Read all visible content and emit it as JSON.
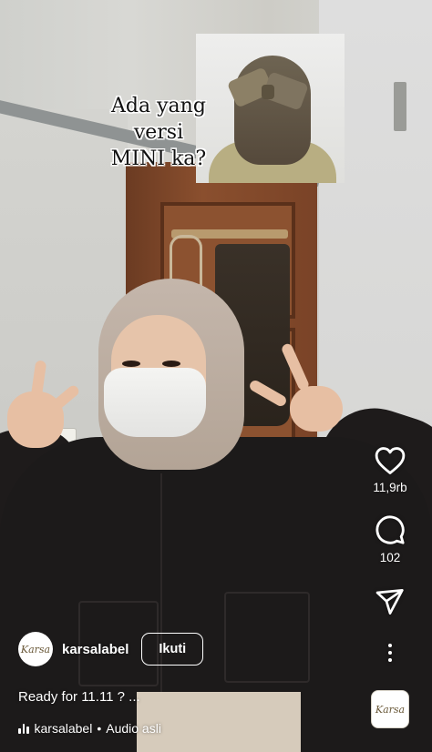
{
  "overlay": {
    "lines": [
      "Ada yang",
      "versi",
      "MINI ka?"
    ]
  },
  "actions": {
    "like_count": "11,9rb",
    "comment_count": "102",
    "audio_thumb_label": "Karsa"
  },
  "user": {
    "avatar_label": "Karsa",
    "username": "karsalabel",
    "follow_label": "Ikuti"
  },
  "caption": {
    "text": "Ready for 11.11 ? ..."
  },
  "audio": {
    "username": "karsalabel",
    "separator": "•",
    "track": "Audio asli"
  },
  "colors": {
    "icon": "#ffffff",
    "text": "#ffffff"
  },
  "icons": [
    "heart-icon",
    "comment-icon",
    "send-icon",
    "more-vertical-icon",
    "audio-wave-icon"
  ]
}
